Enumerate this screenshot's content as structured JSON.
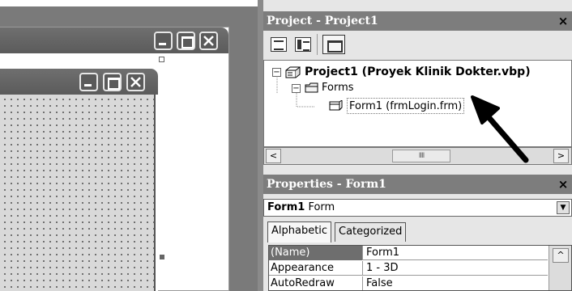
{
  "project_panel": {
    "title": "Project - Project1",
    "close_label": "×",
    "tree": {
      "root_label": "Project1 (Proyek Klinik Dokter.vbp)",
      "root_expander": "−",
      "folder_label": "Forms",
      "folder_expander": "−",
      "item_label": "Form1 (frmLogin.frm)"
    },
    "scroll_left": "<",
    "scroll_right": ">",
    "scroll_thumb": "IIII"
  },
  "properties_panel": {
    "title": "Properties - Form1",
    "close_label": "×",
    "object_name": "Form1",
    "object_type": "Form",
    "combo_arrow": "▼",
    "tabs": [
      "Alphabetic",
      "Categorized"
    ],
    "rows": [
      {
        "name": "(Name)",
        "value": "Form1"
      },
      {
        "name": "Appearance",
        "value": "1 - 3D"
      },
      {
        "name": "AutoRedraw",
        "value": "False"
      }
    ],
    "scroll_up": "^"
  },
  "colors": {
    "title_bar": "#7d7d7d",
    "selected_row": "#6e6e6e"
  },
  "icons": [
    "project-icon",
    "forms-folder-icon",
    "form-icon",
    "view-code-icon",
    "view-object-icon",
    "toggle-folders-icon",
    "pointer-arrow-icon"
  ]
}
